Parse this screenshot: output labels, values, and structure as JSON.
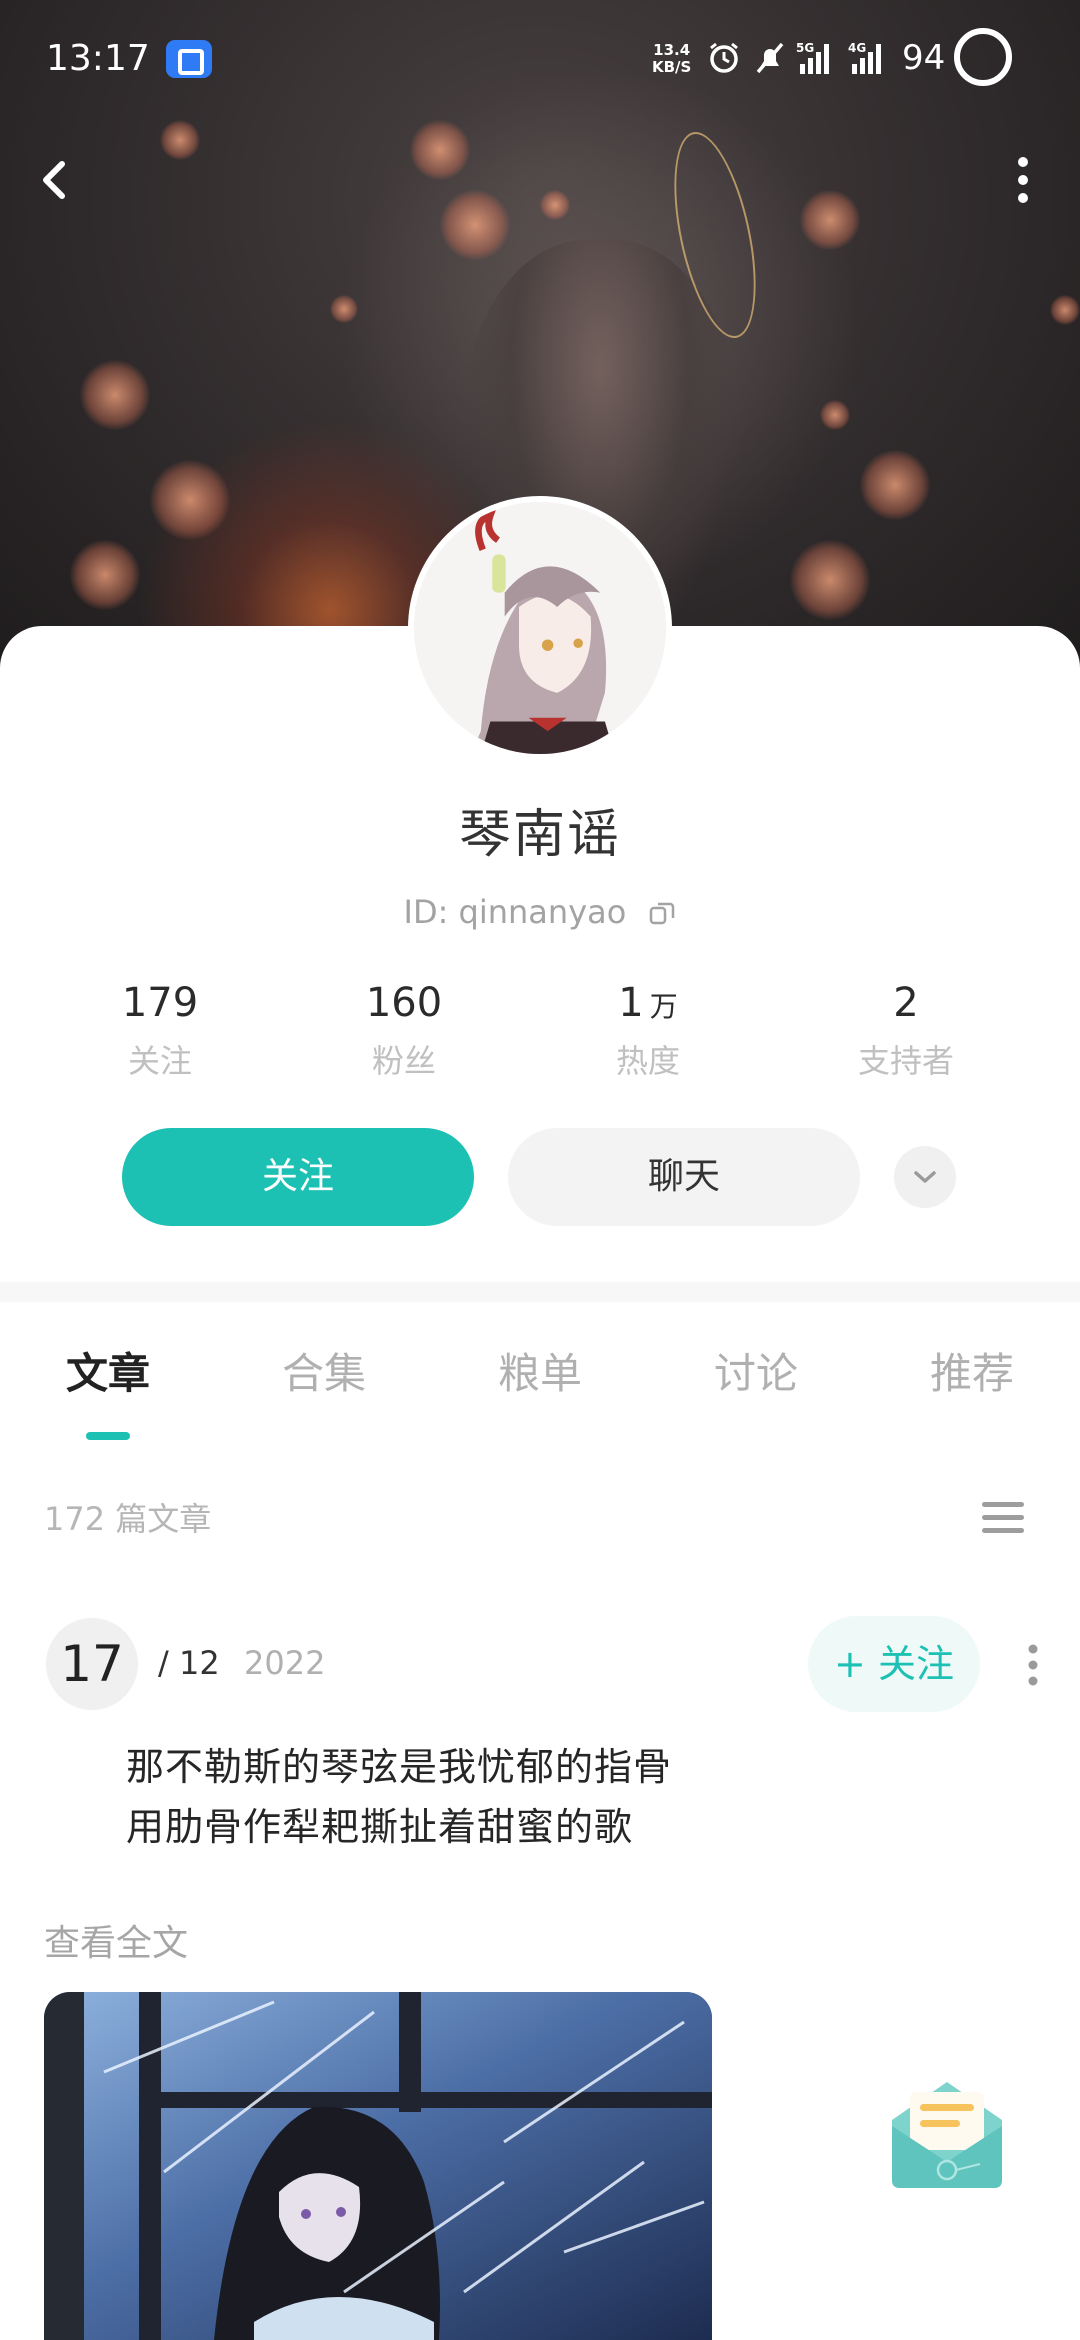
{
  "status_bar": {
    "time": "13:17",
    "net_speed_value": "13.4",
    "net_speed_unit": "KB/S",
    "signal_1": "5G",
    "signal_2": "4G",
    "battery": "94"
  },
  "profile": {
    "name": "琴南谣",
    "id_text": "ID: qinnanyao"
  },
  "stats": [
    {
      "value": "179",
      "unit": "",
      "label": "关注"
    },
    {
      "value": "160",
      "unit": "",
      "label": "粉丝"
    },
    {
      "value": "1",
      "unit": "万",
      "label": "热度"
    },
    {
      "value": "2",
      "unit": "",
      "label": "支持者"
    }
  ],
  "actions": {
    "follow_label": "关注",
    "chat_label": "聊天"
  },
  "tabs": [
    {
      "label": "文章",
      "active": true
    },
    {
      "label": "合集",
      "active": false
    },
    {
      "label": "粮单",
      "active": false
    },
    {
      "label": "讨论",
      "active": false
    },
    {
      "label": "推荐",
      "active": false
    }
  ],
  "articles": {
    "count_text": "172 篇文章"
  },
  "post": {
    "day": "17",
    "month": "/ 12",
    "year": "2022",
    "follow_label": "+ 关注",
    "lines": [
      "那不勒斯的琴弦是我忧郁的指骨",
      "用肋骨作犁耙撕扯着甜蜜的歌"
    ],
    "read_more": "查看全文"
  },
  "colors": {
    "accent": "#1dc1b3",
    "muted_text": "#b0b0b0"
  }
}
